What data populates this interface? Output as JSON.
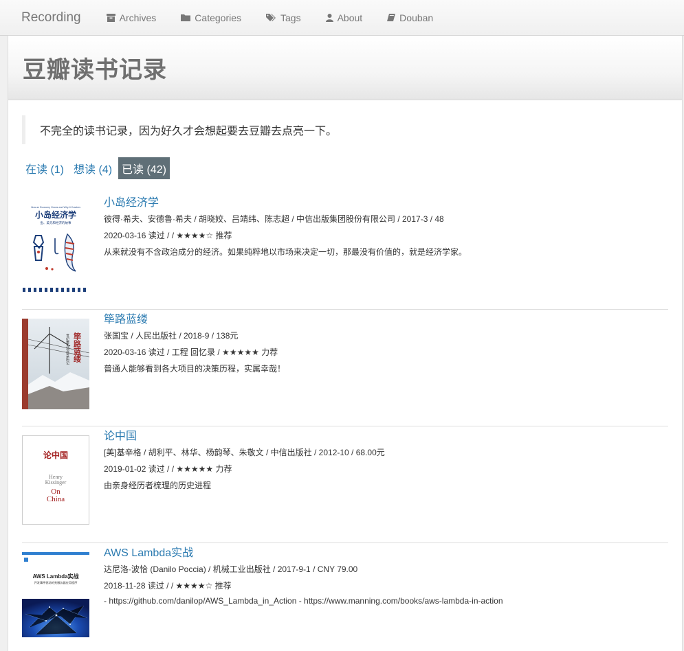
{
  "nav": {
    "brand": "Recording",
    "items": [
      {
        "label": "Archives",
        "icon": "archive-icon"
      },
      {
        "label": "Categories",
        "icon": "folder-icon"
      },
      {
        "label": "Tags",
        "icon": "tags-icon"
      },
      {
        "label": "About",
        "icon": "user-icon"
      },
      {
        "label": "Douban",
        "icon": "book-icon"
      }
    ]
  },
  "page": {
    "title": "豆瓣读书记录",
    "quote": "不完全的读书记录，因为好久才会想起要去豆瓣去点亮一下。"
  },
  "tabs": [
    {
      "label": "在读 (1)",
      "active": false
    },
    {
      "label": "想读 (4)",
      "active": false
    },
    {
      "label": "已读 (42)",
      "active": true
    }
  ],
  "books": [
    {
      "title": "小岛经济学",
      "info": "彼得·希夫、安德鲁·希夫 / 胡晓姣、吕靖纬、陈志超 / 中信出版集团股份有限公司 / 2017-3 / 48",
      "meta": "2020-03-16 读过 / / ★★★★☆ 推荐",
      "comment": "从来就没有不含政治成分的经济。如果纯粹地以市场来决定一切，那最没有价值的，就是经济学家。",
      "cover": {
        "title": "小岛经济学",
        "subtitle": "鱼、美元和经济的故事",
        "eng": "How an Economy Grows and Why It Crashes"
      }
    },
    {
      "title": "筚路蓝缕",
      "info": "张国宝 / 人民出版社 / 2018-9 / 138元",
      "meta": "2020-03-16 读过 / 工程 回忆录 / ★★★★★ 力荐",
      "comment": "普通人能够看到各大项目的决策历程，实属幸哉！",
      "cover": {
        "title": "筚路蓝缕",
        "subtitle": "世纪重大项目亲历记"
      }
    },
    {
      "title": "论中国",
      "info": "[美]基辛格 / 胡利平、林华、杨韵琴、朱敬文 / 中信出版社 / 2012-10 / 68.00元",
      "meta": "2019-01-02 读过 / / ★★★★★ 力荐",
      "comment": "由亲身经历者梳理的历史进程",
      "cover": {
        "title": "论中国",
        "line1": "Henry",
        "line2": "Kissinger",
        "line3": "On",
        "line4": "China"
      }
    },
    {
      "title": "AWS Lambda实战",
      "info": "达尼洛·波恰 (Danilo Poccia) / 机械工业出版社 / 2017-9-1 / CNY 79.00",
      "meta": "2018-11-28 读过 / / ★★★★☆ 推荐",
      "comment": "- https://github.com/danilop/AWS_Lambda_in_Action - https://www.manning.com/books/aws-lambda-in-action",
      "cover": {
        "title": "AWS Lambda实战",
        "subtitle": "开发事件驱动的无服务器应用程序"
      }
    }
  ]
}
